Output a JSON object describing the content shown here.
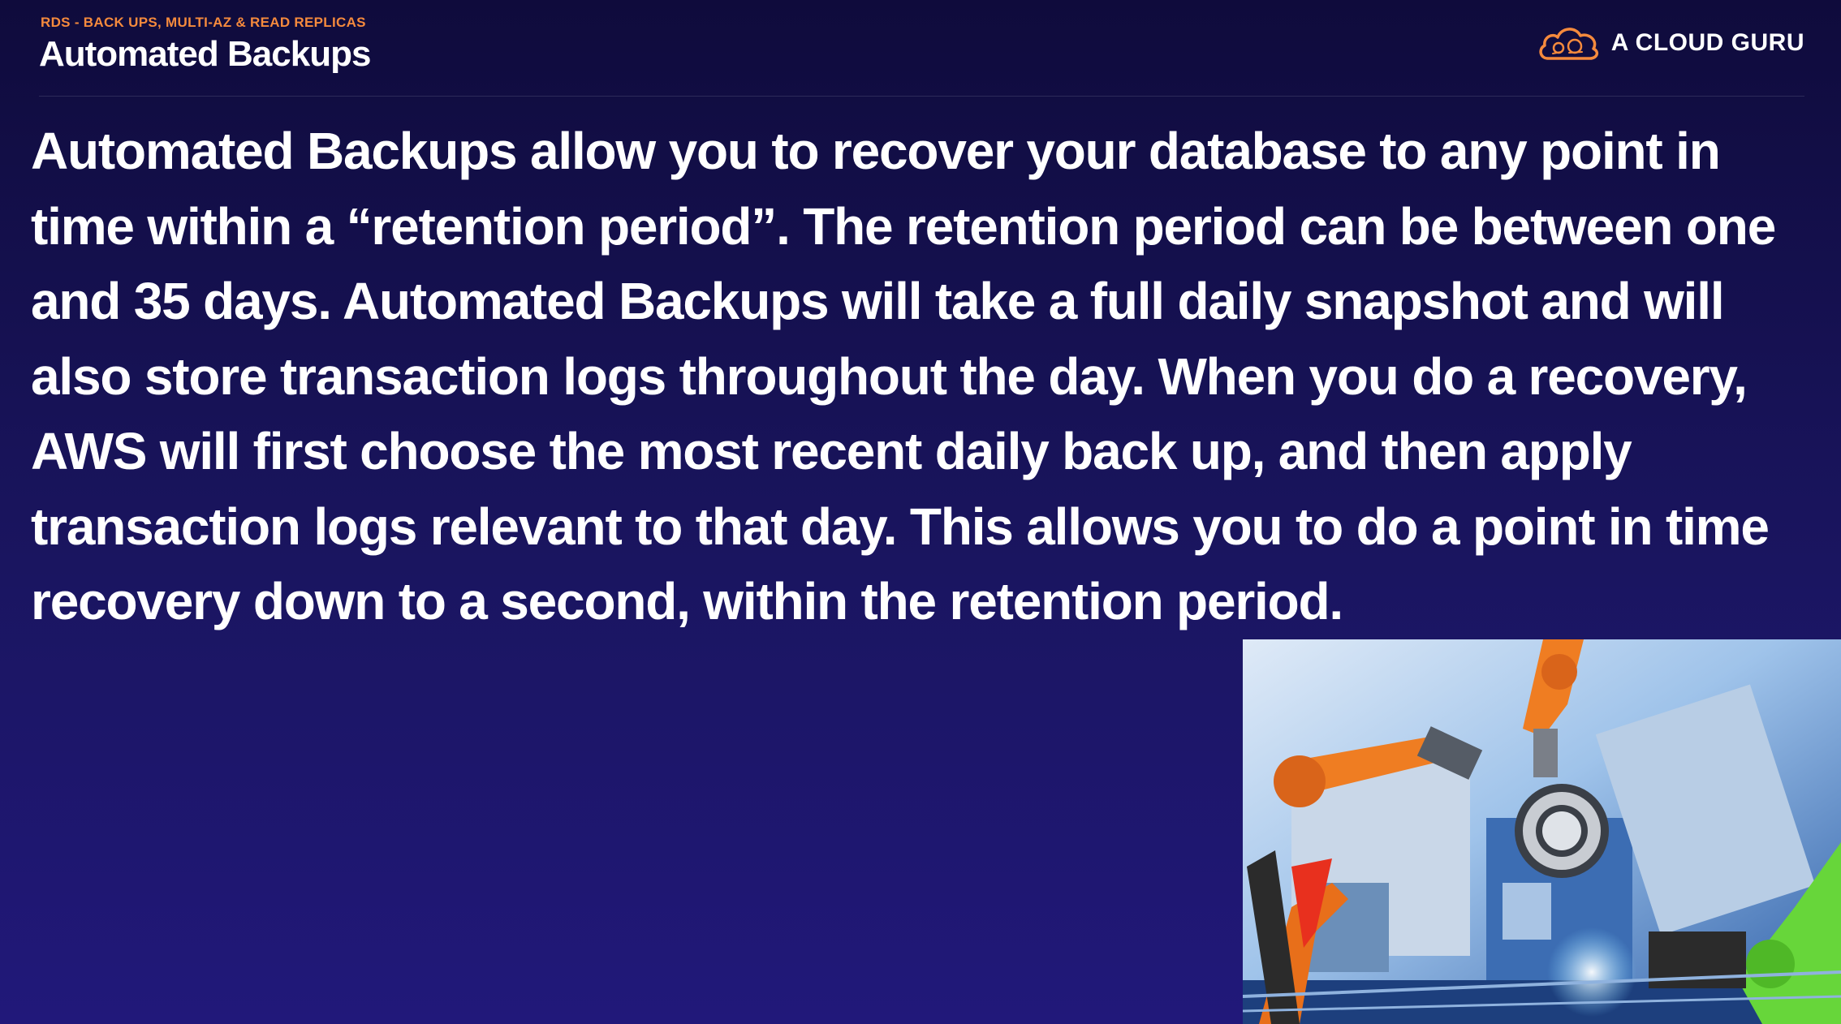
{
  "header": {
    "kicker": "RDS - BACK UPS, MULTI-AZ & READ REPLICAS",
    "title": "Automated Backups"
  },
  "brand": {
    "name": "A CLOUD GURU",
    "logo_icon": "cloud-logo-icon",
    "accent_color": "#f58a3d"
  },
  "content": {
    "paragraph": "Automated Backups allow you to recover your database to any point in time within a “retention period”. The retention period can be between one and 35 days. Automated Backups will take a full daily snapshot and will also store transaction logs throughout the day. When you do a recovery, AWS will first choose the most recent daily back up, and then apply transaction logs relevant to that day. This allows you to do a point in time recovery down to a second, within the retention period."
  },
  "image": {
    "subject": "industrial-robot-arms-photo"
  },
  "colors": {
    "background_top": "#0f0b3c",
    "background_bottom": "#21187a",
    "text": "#ffffff",
    "kicker": "#f58a3d"
  }
}
